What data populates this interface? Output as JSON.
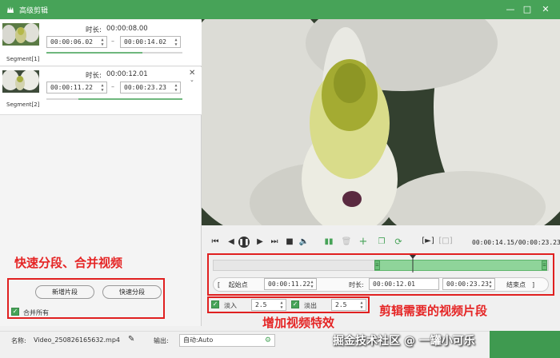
{
  "app": {
    "title": "高级剪辑"
  },
  "segments": [
    {
      "label": "Segment[1]",
      "duration_label": "时长:",
      "duration": "00:00:08.00",
      "start": "00:00:06.02",
      "end": "00:00:14.02"
    },
    {
      "label": "Segment[2]",
      "duration_label": "时长:",
      "duration": "00:00:12.01",
      "start": "00:00:11.22",
      "end": "00:00:23.23"
    }
  ],
  "left_actions": {
    "add_segment": "新增片段",
    "quick_split": "快速分段",
    "merge_all": "合并所有"
  },
  "annotations": {
    "left": "快速分段、合并视频",
    "effects": "增加视频特效",
    "right": "剪辑需要的视频片段"
  },
  "player": {
    "current_time": "00:00:14.15",
    "total_time": "00:00:23.23"
  },
  "trim": {
    "start_label": "起始点",
    "start_value": "00:00:11.22",
    "duration_label": "时长:",
    "duration_value": "00:00:12.01",
    "end_value": "00:00:23.23",
    "end_label": "结束点"
  },
  "effects": {
    "fade_in_label": "淡入",
    "fade_in_value": "2.5",
    "fade_out_label": "淡出",
    "fade_out_value": "2.5"
  },
  "footer": {
    "name_label": "名称:",
    "name_value": "Video_250826165632.mp4",
    "output_label": "输出:",
    "output_value": "自动:Auto"
  },
  "watermark": {
    "text": "掘金技术社区 @ 一罐小可乐"
  },
  "icons": {
    "accent": "#47a358",
    "annotation_red": "#e02020"
  }
}
